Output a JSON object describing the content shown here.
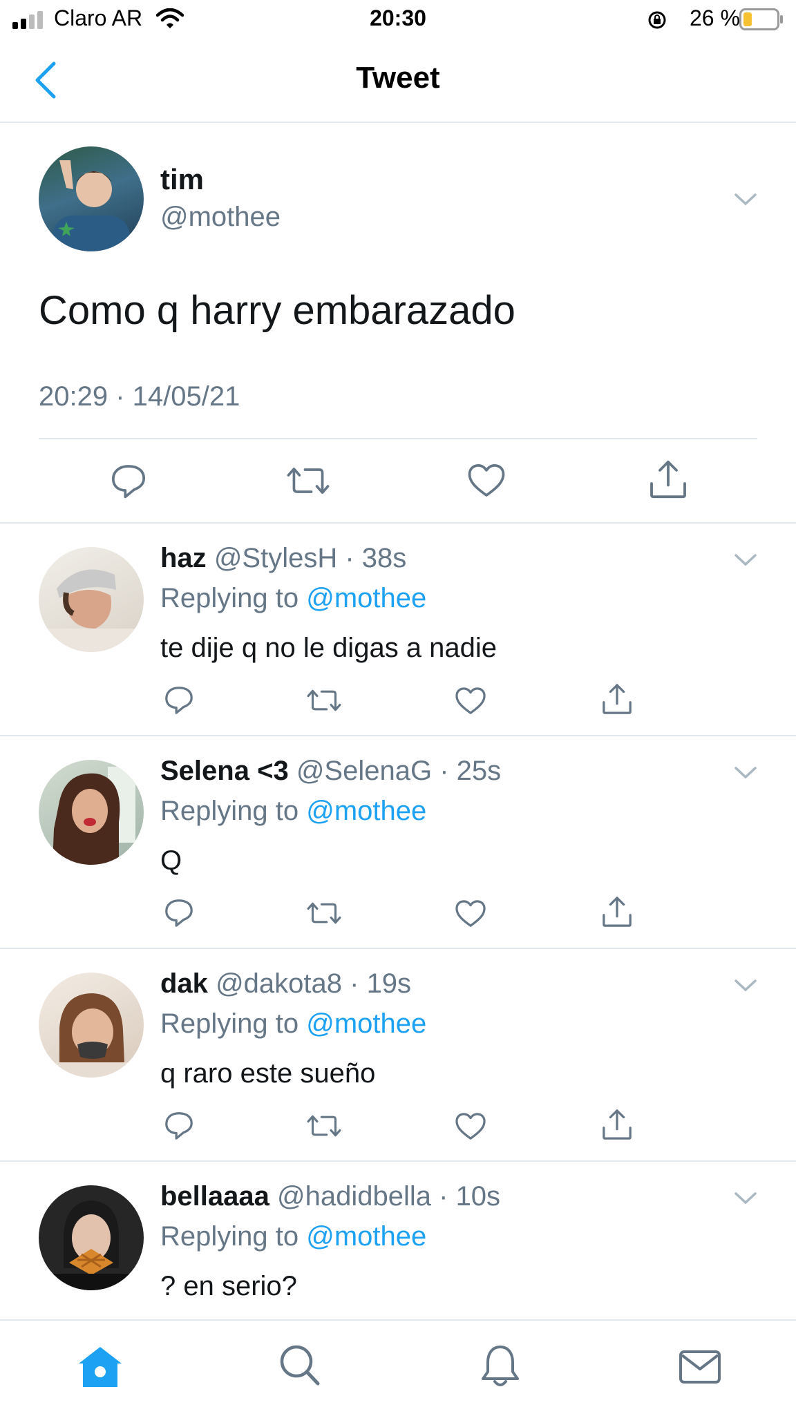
{
  "status_bar": {
    "carrier": "Claro AR",
    "time": "20:30",
    "battery": "26 %",
    "battery_level": 0.26
  },
  "nav": {
    "back_icon": "chevron-left-icon",
    "title": "Tweet"
  },
  "tweet": {
    "display_name": "tim",
    "handle": "@mothee",
    "text": "Como q harry embarazado",
    "timestamp": "20:29 · 14/05/21",
    "actions": [
      "reply-icon",
      "retweet-icon",
      "like-icon",
      "share-icon"
    ]
  },
  "replies": [
    {
      "display_name": "haz",
      "handle": "@StylesH",
      "age": "38s",
      "replying_prefix": "Replying to",
      "replying_to": "@mothee",
      "text": "te dije q no le digas a nadie"
    },
    {
      "display_name": "Selena <3",
      "handle": "@SelenaG",
      "age": "25s",
      "replying_prefix": "Replying to",
      "replying_to": "@mothee",
      "text": "Q"
    },
    {
      "display_name": "dak",
      "handle": "@dakota8",
      "age": "19s",
      "replying_prefix": "Replying to",
      "replying_to": "@mothee",
      "text": "q raro este sueño"
    },
    {
      "display_name": "bellaaaa",
      "handle": "@hadidbella",
      "age": "10s",
      "replying_prefix": "Replying to",
      "replying_to": "@mothee",
      "text": "? en serio?"
    }
  ],
  "tab_bar": {
    "items": [
      "home-icon",
      "search-icon",
      "notifications-icon",
      "messages-icon"
    ],
    "active": "home-icon"
  },
  "colors": {
    "accent": "#1da1f2",
    "text": "#14171a",
    "secondary": "#657786",
    "divider": "#e1e8ed"
  }
}
